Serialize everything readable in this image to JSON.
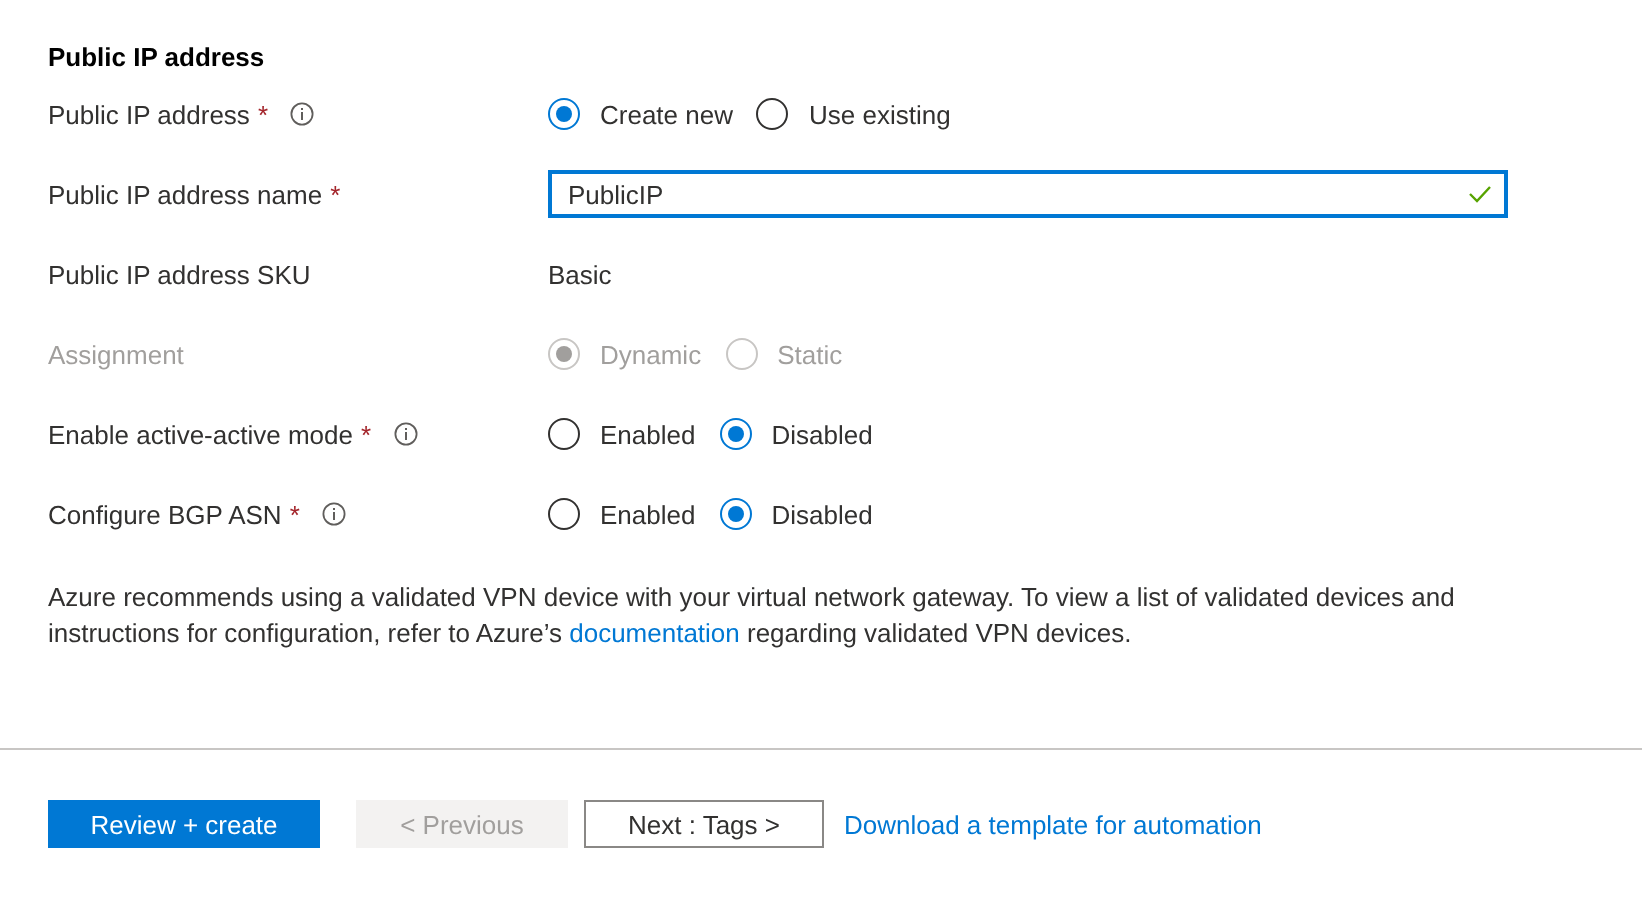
{
  "section_title": "Public IP address",
  "fields": [
    {
      "kind": "radio",
      "label": "Public IP address",
      "required": true,
      "info": true,
      "disabled": false,
      "options": [
        {
          "label": "Create new",
          "selected": true
        },
        {
          "label": "Use existing",
          "selected": false
        }
      ]
    },
    {
      "kind": "input",
      "label": "Public IP address name",
      "required": true,
      "info": false,
      "disabled": false,
      "value": "PublicIP",
      "valid": true
    },
    {
      "kind": "static",
      "label": "Public IP address SKU",
      "required": false,
      "info": false,
      "disabled": false,
      "value": "Basic"
    },
    {
      "kind": "radio",
      "label": "Assignment",
      "required": false,
      "info": false,
      "disabled": true,
      "options": [
        {
          "label": "Dynamic",
          "selected": true
        },
        {
          "label": "Static",
          "selected": false
        }
      ]
    },
    {
      "kind": "radio",
      "label": "Enable active-active mode",
      "required": true,
      "info": true,
      "disabled": false,
      "options": [
        {
          "label": "Enabled",
          "selected": false
        },
        {
          "label": "Disabled",
          "selected": true
        }
      ]
    },
    {
      "kind": "radio",
      "label": "Configure BGP ASN",
      "required": true,
      "info": true,
      "disabled": false,
      "options": [
        {
          "label": "Enabled",
          "selected": false
        },
        {
          "label": "Disabled",
          "selected": true
        }
      ]
    }
  ],
  "note": {
    "before": "Azure recommends using a validated VPN device with your virtual network gateway. To view a list of validated devices and instructions for configuration, refer to Azure’s",
    "link": "documentation",
    "after": "regarding validated VPN devices."
  },
  "required_mark": "*",
  "footer": [
    {
      "kind": "primary",
      "label": "Review + create",
      "disabled": false
    },
    {
      "kind": "secondary",
      "label": "< Previous",
      "disabled": true
    },
    {
      "kind": "secondary",
      "label": "Next : Tags >",
      "disabled": false
    },
    {
      "kind": "link",
      "label": "Download a template for automation",
      "disabled": false
    }
  ]
}
